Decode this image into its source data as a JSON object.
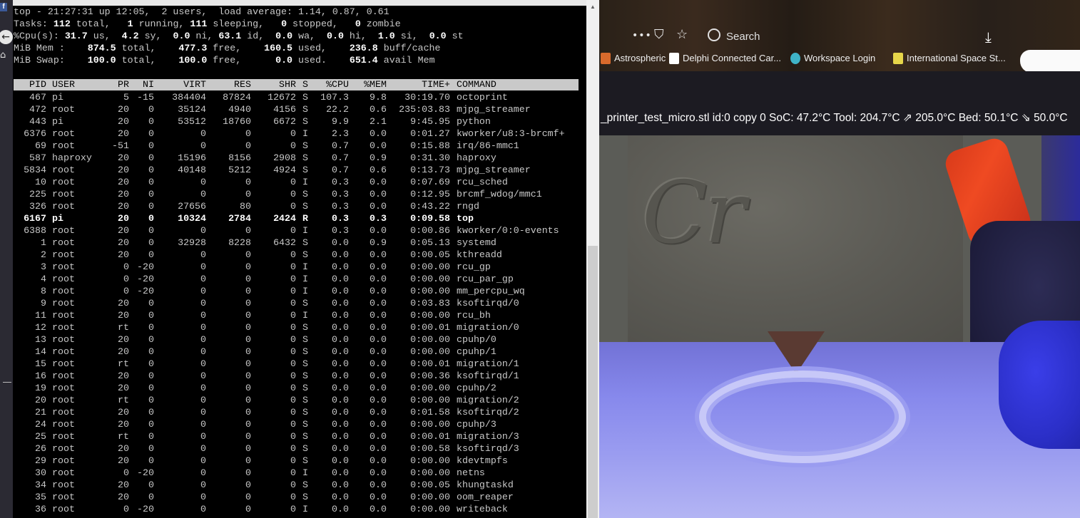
{
  "left_strip": {
    "fb_label": "f",
    "back_glyph": "←",
    "home_glyph": "⌂"
  },
  "terminal": {
    "summary": [
      "top - 21:27:31 up 12:05,  2 users,  load average: 1.14, 0.87, 0.61",
      "Tasks: 112 total,   1 running, 111 sleeping,   0 stopped,   0 zombie",
      "%Cpu(s): 31.7 us,  4.2 sy,  0.0 ni, 63.1 id,  0.0 wa,  0.0 hi,  1.0 si,  0.0 st",
      "MiB Mem :    874.5 total,    477.3 free,    160.5 used,    236.8 buff/cache",
      "MiB Swap:    100.0 total,    100.0 free,      0.0 used.    651.4 avail Mem"
    ],
    "columns": [
      "PID",
      "USER",
      "PR",
      "NI",
      "VIRT",
      "RES",
      "SHR",
      "S",
      "%CPU",
      "%MEM",
      "TIME+",
      "COMMAND"
    ],
    "processes": [
      [
        "467",
        "pi",
        "5",
        "-15",
        "384404",
        "87824",
        "12672",
        "S",
        "107.3",
        "9.8",
        "30:19.70",
        "octoprint"
      ],
      [
        "472",
        "root",
        "20",
        "0",
        "35124",
        "4940",
        "4156",
        "S",
        "22.2",
        "0.6",
        "235:03.83",
        "mjpg_streamer"
      ],
      [
        "443",
        "pi",
        "20",
        "0",
        "53512",
        "18760",
        "6672",
        "S",
        "9.9",
        "2.1",
        "9:45.95",
        "python"
      ],
      [
        "6376",
        "root",
        "20",
        "0",
        "0",
        "0",
        "0",
        "I",
        "2.3",
        "0.0",
        "0:01.27",
        "kworker/u8:3-brcmf+"
      ],
      [
        "69",
        "root",
        "-51",
        "0",
        "0",
        "0",
        "0",
        "S",
        "0.7",
        "0.0",
        "0:15.88",
        "irq/86-mmc1"
      ],
      [
        "587",
        "haproxy",
        "20",
        "0",
        "15196",
        "8156",
        "2908",
        "S",
        "0.7",
        "0.9",
        "0:31.30",
        "haproxy"
      ],
      [
        "5834",
        "root",
        "20",
        "0",
        "40148",
        "5212",
        "4924",
        "S",
        "0.7",
        "0.6",
        "0:13.73",
        "mjpg_streamer"
      ],
      [
        "10",
        "root",
        "20",
        "0",
        "0",
        "0",
        "0",
        "I",
        "0.3",
        "0.0",
        "0:07.69",
        "rcu_sched"
      ],
      [
        "225",
        "root",
        "20",
        "0",
        "0",
        "0",
        "0",
        "S",
        "0.3",
        "0.0",
        "0:12.95",
        "brcmf_wdog/mmc1"
      ],
      [
        "326",
        "root",
        "20",
        "0",
        "27656",
        "80",
        "0",
        "S",
        "0.3",
        "0.0",
        "0:43.22",
        "rngd"
      ],
      [
        "6167",
        "pi",
        "20",
        "0",
        "10324",
        "2784",
        "2424",
        "R",
        "0.3",
        "0.3",
        "0:09.58",
        "top"
      ],
      [
        "6388",
        "root",
        "20",
        "0",
        "0",
        "0",
        "0",
        "I",
        "0.3",
        "0.0",
        "0:00.86",
        "kworker/0:0-events"
      ],
      [
        "1",
        "root",
        "20",
        "0",
        "32928",
        "8228",
        "6432",
        "S",
        "0.0",
        "0.9",
        "0:05.13",
        "systemd"
      ],
      [
        "2",
        "root",
        "20",
        "0",
        "0",
        "0",
        "0",
        "S",
        "0.0",
        "0.0",
        "0:00.05",
        "kthreadd"
      ],
      [
        "3",
        "root",
        "0",
        "-20",
        "0",
        "0",
        "0",
        "I",
        "0.0",
        "0.0",
        "0:00.00",
        "rcu_gp"
      ],
      [
        "4",
        "root",
        "0",
        "-20",
        "0",
        "0",
        "0",
        "I",
        "0.0",
        "0.0",
        "0:00.00",
        "rcu_par_gp"
      ],
      [
        "8",
        "root",
        "0",
        "-20",
        "0",
        "0",
        "0",
        "I",
        "0.0",
        "0.0",
        "0:00.00",
        "mm_percpu_wq"
      ],
      [
        "9",
        "root",
        "20",
        "0",
        "0",
        "0",
        "0",
        "S",
        "0.0",
        "0.0",
        "0:03.83",
        "ksoftirqd/0"
      ],
      [
        "11",
        "root",
        "20",
        "0",
        "0",
        "0",
        "0",
        "I",
        "0.0",
        "0.0",
        "0:00.00",
        "rcu_bh"
      ],
      [
        "12",
        "root",
        "rt",
        "0",
        "0",
        "0",
        "0",
        "S",
        "0.0",
        "0.0",
        "0:00.01",
        "migration/0"
      ],
      [
        "13",
        "root",
        "20",
        "0",
        "0",
        "0",
        "0",
        "S",
        "0.0",
        "0.0",
        "0:00.00",
        "cpuhp/0"
      ],
      [
        "14",
        "root",
        "20",
        "0",
        "0",
        "0",
        "0",
        "S",
        "0.0",
        "0.0",
        "0:00.00",
        "cpuhp/1"
      ],
      [
        "15",
        "root",
        "rt",
        "0",
        "0",
        "0",
        "0",
        "S",
        "0.0",
        "0.0",
        "0:00.01",
        "migration/1"
      ],
      [
        "16",
        "root",
        "20",
        "0",
        "0",
        "0",
        "0",
        "S",
        "0.0",
        "0.0",
        "0:00.36",
        "ksoftirqd/1"
      ],
      [
        "19",
        "root",
        "20",
        "0",
        "0",
        "0",
        "0",
        "S",
        "0.0",
        "0.0",
        "0:00.00",
        "cpuhp/2"
      ],
      [
        "20",
        "root",
        "rt",
        "0",
        "0",
        "0",
        "0",
        "S",
        "0.0",
        "0.0",
        "0:00.00",
        "migration/2"
      ],
      [
        "21",
        "root",
        "20",
        "0",
        "0",
        "0",
        "0",
        "S",
        "0.0",
        "0.0",
        "0:01.58",
        "ksoftirqd/2"
      ],
      [
        "24",
        "root",
        "20",
        "0",
        "0",
        "0",
        "0",
        "S",
        "0.0",
        "0.0",
        "0:00.00",
        "cpuhp/3"
      ],
      [
        "25",
        "root",
        "rt",
        "0",
        "0",
        "0",
        "0",
        "S",
        "0.0",
        "0.0",
        "0:00.01",
        "migration/3"
      ],
      [
        "26",
        "root",
        "20",
        "0",
        "0",
        "0",
        "0",
        "S",
        "0.0",
        "0.0",
        "0:00.58",
        "ksoftirqd/3"
      ],
      [
        "29",
        "root",
        "20",
        "0",
        "0",
        "0",
        "0",
        "S",
        "0.0",
        "0.0",
        "0:00.00",
        "kdevtmpfs"
      ],
      [
        "30",
        "root",
        "0",
        "-20",
        "0",
        "0",
        "0",
        "I",
        "0.0",
        "0.0",
        "0:00.00",
        "netns"
      ],
      [
        "34",
        "root",
        "20",
        "0",
        "0",
        "0",
        "0",
        "S",
        "0.0",
        "0.0",
        "0:00.05",
        "khungtaskd"
      ],
      [
        "35",
        "root",
        "20",
        "0",
        "0",
        "0",
        "0",
        "S",
        "0.0",
        "0.0",
        "0:00.00",
        "oom_reaper"
      ],
      [
        "36",
        "root",
        "0",
        "-20",
        "0",
        "0",
        "0",
        "I",
        "0.0",
        "0.0",
        "0:00.00",
        "writeback"
      ]
    ],
    "highlight_pid": "6167"
  },
  "browser": {
    "toolbar": {
      "more_glyph": "•••",
      "pocket_glyph": "⛉",
      "star_glyph": "☆",
      "search_placeholder": "Search",
      "download_glyph": "⤓"
    },
    "bookmarks": [
      {
        "label": "Astrospheric",
        "icon": "astrospheric-icon",
        "color": "#d86a2c"
      },
      {
        "label": "Delphi Connected Car...",
        "icon": "document-icon",
        "color": "#ffffff"
      },
      {
        "label": "Workspace Login",
        "icon": "workspace-icon",
        "color": "#3fb3c7"
      },
      {
        "label": "International Space St...",
        "icon": "iss-icon",
        "color": "#e6d64a"
      }
    ],
    "status_line": "_printer_test_micro.stl id:0 copy 0   SoC: 47.2°C Tool: 204.7°C ⇗ 205.0°C Bed: 50.1°C ⇘ 50.0°C",
    "webcam_text": "Cr"
  }
}
